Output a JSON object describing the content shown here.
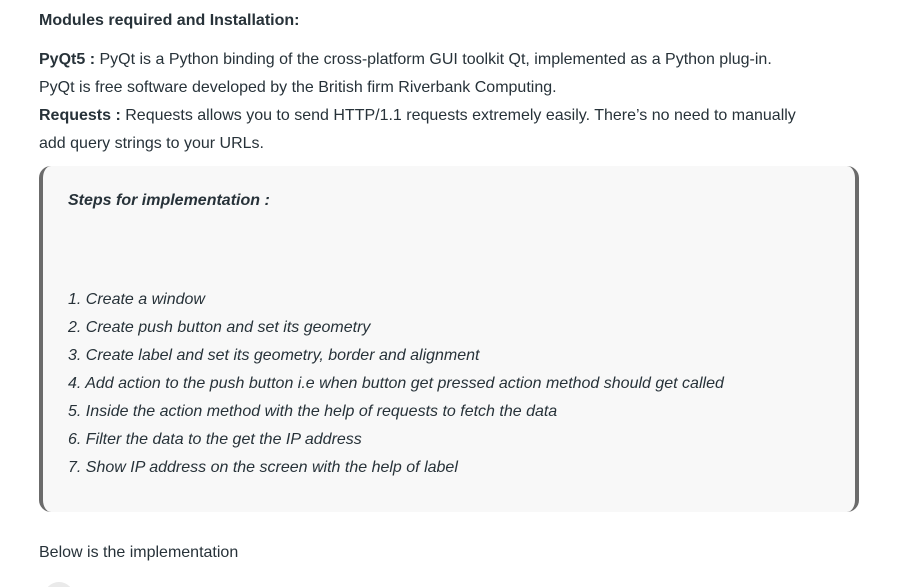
{
  "heading": "Modules required and Installation:",
  "modules": [
    {
      "name": "PyQt5 :",
      "lines": [
        " PyQt is a Python binding of the cross-platform GUI toolkit Qt, implemented as a Python plug-in.",
        "PyQt is free software developed by the British firm Riverbank Computing."
      ]
    },
    {
      "name": "Requests :",
      "lines": [
        " Requests allows you to send HTTP/1.1 requests extremely easily. There’s no need to manually",
        "add query strings to your URLs."
      ]
    }
  ],
  "steps_box": {
    "title": "Steps for implementation :",
    "steps": [
      "1. Create a window",
      "2. Create push button and set its geometry",
      "3. Create label and set its geometry, border and alignment",
      "4. Add action to the push button i.e when button get pressed action method should get called",
      "5. Inside the action method with the help of requests to fetch the data",
      "6. Filter the data to the get the IP address",
      "7. Show IP address on the screen with the help of label"
    ]
  },
  "footer_text": "Below is the implementation"
}
